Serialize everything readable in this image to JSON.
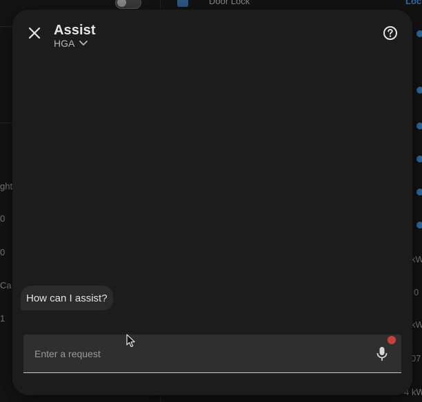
{
  "background": {
    "toggle": "off",
    "lock_card": {
      "title": "Door Lock",
      "action": "Loc"
    },
    "left_labels": [
      "ght",
      "0",
      "0",
      "Ca",
      "1"
    ],
    "right_labels": [
      "kW",
      "0",
      "kW",
      "07",
      "4 kW"
    ]
  },
  "dialog": {
    "title": "Assist",
    "pipeline": "HGA",
    "icons": {
      "close": "close-icon",
      "pipeline_dropdown": "chevron-down-icon",
      "help": "help-circle-icon",
      "mic": "microphone-icon"
    },
    "messages": [
      {
        "from": "assistant",
        "text": "How can I assist?"
      }
    ],
    "input": {
      "placeholder": "Enter a request",
      "value": ""
    },
    "colors": {
      "surface": "#1c1c1c",
      "bubble": "#2b2b2b",
      "field": "#2f2f2f",
      "badge": "#c9403a"
    }
  }
}
